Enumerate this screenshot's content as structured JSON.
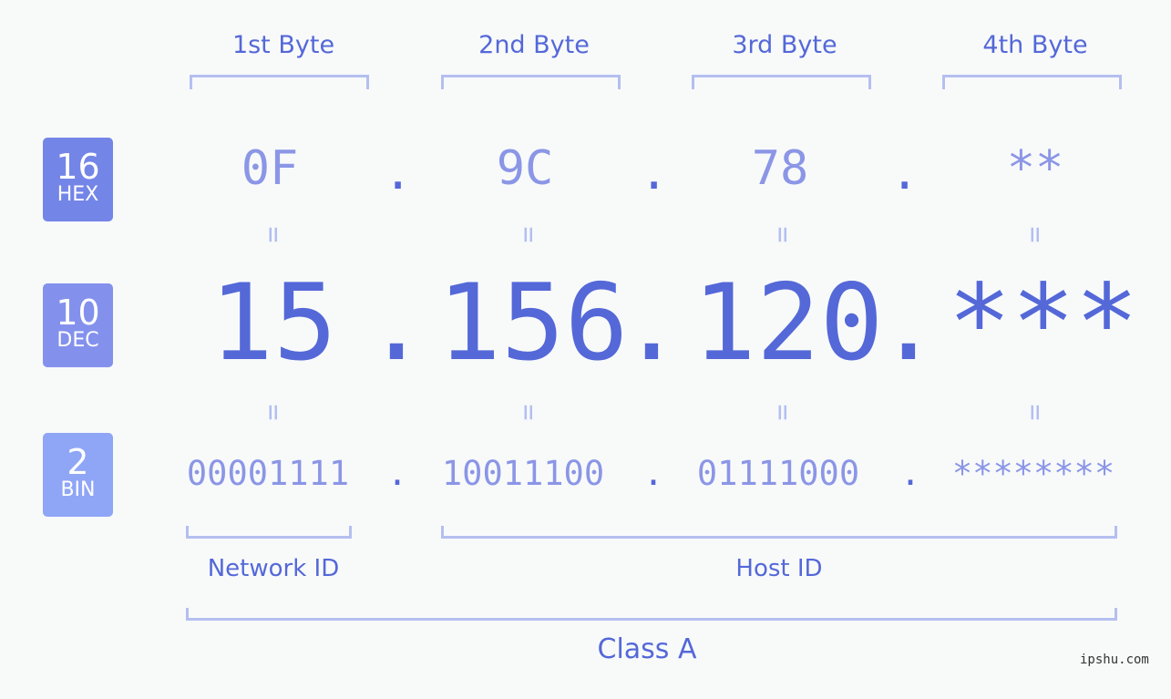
{
  "headers": [
    "1st Byte",
    "2nd Byte",
    "3rd Byte",
    "4th Byte"
  ],
  "badges": [
    {
      "num": "16",
      "label": "HEX",
      "color": "#7485e8"
    },
    {
      "num": "10",
      "label": "DEC",
      "color": "#8391ed"
    },
    {
      "num": "2",
      "label": "BIN",
      "color": "#8fa5f6"
    }
  ],
  "hex": [
    "0F",
    "9C",
    "78",
    "**"
  ],
  "dec": [
    "15",
    "156",
    "120",
    "***"
  ],
  "bin": [
    "00001111",
    "10011100",
    "01111000",
    "********"
  ],
  "separator": ".",
  "equals": "=",
  "segments": {
    "network": "Network ID",
    "host": "Host ID",
    "class": "Class A"
  },
  "watermark": "ipshu.com"
}
